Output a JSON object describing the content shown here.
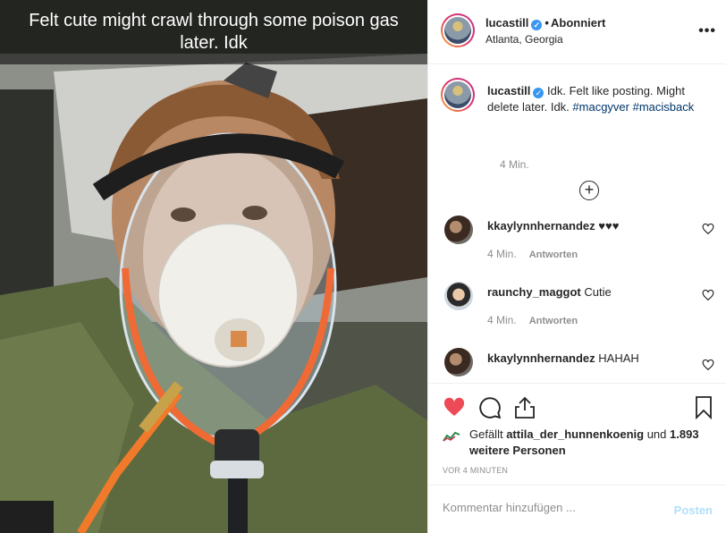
{
  "photo": {
    "caption_overlay": "Felt cute might crawl through some poison gas later. Idk"
  },
  "header": {
    "username": "lucastill",
    "verified_icon": "verified-badge-icon",
    "separator": "•",
    "follow_status": "Abonniert",
    "location": "Atlanta, Georgia",
    "more_icon": "more-options-icon"
  },
  "caption": {
    "username": "lucastill",
    "text": "Idk. Felt like posting. Might delete later. Idk.",
    "hashtags": [
      "#macgyver",
      "#macisback"
    ],
    "time": "4 Min."
  },
  "load_more_icon": "plus-circle-icon",
  "comments": [
    {
      "username": "kkaylynnhernandez",
      "text": "♥♥♥",
      "time": "4 Min.",
      "reply_label": "Antworten"
    },
    {
      "username": "raunchy_maggot",
      "text": "Cutie",
      "time": "4 Min.",
      "reply_label": "Antworten"
    },
    {
      "username": "kkaylynnhernandez",
      "text": "HAHAH",
      "time": "",
      "reply_label": ""
    }
  ],
  "actions": {
    "like_icon": "heart-filled-icon",
    "comment_icon": "comment-icon",
    "share_icon": "share-icon",
    "save_icon": "bookmark-icon",
    "like_color": "#ed4956"
  },
  "likes": {
    "prefix": "Gefällt",
    "user": "attila_der_hunnenkoenig",
    "conjunction": "und",
    "count_text": "1.893 weitere Personen"
  },
  "timestamp": "VOR 4 MINUTEN",
  "comment_box": {
    "placeholder": "Kommentar hinzufügen ...",
    "post_label": "Posten"
  }
}
